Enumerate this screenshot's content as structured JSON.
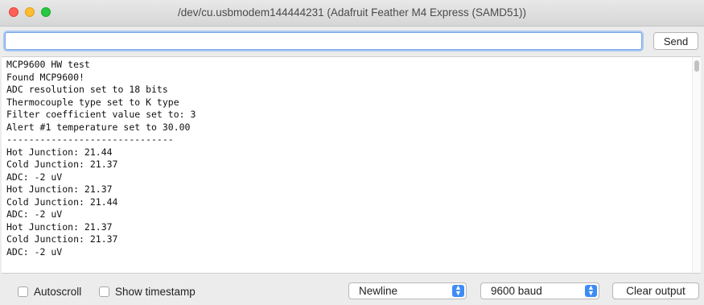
{
  "window": {
    "title": "/dev/cu.usbmodem144444231 (Adafruit Feather M4 Express (SAMD51))"
  },
  "input": {
    "value": "",
    "placeholder": "",
    "send_label": "Send"
  },
  "output": {
    "lines": [
      "MCP9600 HW test",
      "Found MCP9600!",
      "ADC resolution set to 18 bits",
      "Thermocouple type set to K type",
      "Filter coefficient value set to: 3",
      "Alert #1 temperature set to 30.00",
      "------------------------------",
      "Hot Junction: 21.44",
      "Cold Junction: 21.37",
      "ADC: -2 uV",
      "Hot Junction: 21.37",
      "Cold Junction: 21.44",
      "ADC: -2 uV",
      "Hot Junction: 21.37",
      "Cold Junction: 21.37",
      "ADC: -2 uV"
    ]
  },
  "footer": {
    "autoscroll_label": "Autoscroll",
    "autoscroll_checked": false,
    "timestamp_label": "Show timestamp",
    "timestamp_checked": false,
    "line_ending": "Newline",
    "baud_rate": "9600 baud",
    "clear_label": "Clear output"
  },
  "colors": {
    "close": "#fe5f57",
    "minimize": "#febc2e",
    "zoom": "#28c840",
    "select_accent": "#3d8cf5",
    "focus_ring": "#a9c8f3"
  },
  "icons": [
    "close-light",
    "minimize-light",
    "zoom-light",
    "chevron-updown-icon"
  ]
}
